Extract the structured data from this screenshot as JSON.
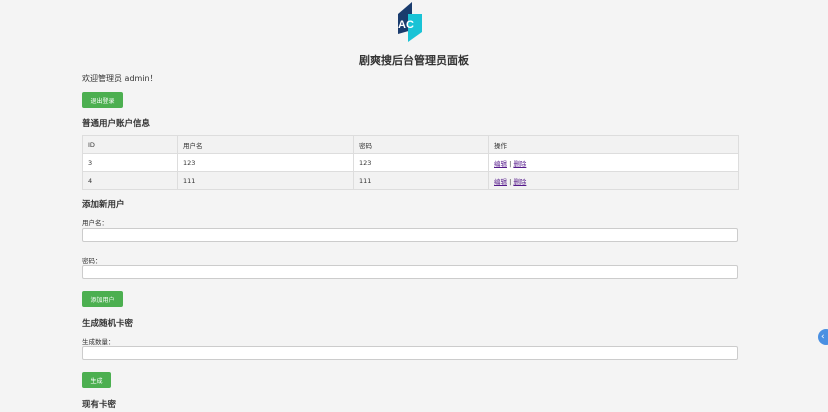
{
  "header": {
    "logo_text": "AC",
    "title": "剧爽搜后台管理员面板"
  },
  "welcome_text": "欢迎管理员 admin！",
  "logout_button": "退出登录",
  "users_section": {
    "heading": "普通用户账户信息",
    "columns": [
      "ID",
      "用户名",
      "密码",
      "操作"
    ],
    "rows": [
      {
        "id": "3",
        "username": "123",
        "password": "123",
        "edit": "编辑",
        "sep": "|",
        "delete": "删除"
      },
      {
        "id": "4",
        "username": "111",
        "password": "111",
        "edit": "编辑",
        "sep": "|",
        "delete": "删除"
      }
    ]
  },
  "add_user": {
    "heading": "添加新用户",
    "username_label": "用户名：",
    "username_value": "",
    "password_label": "密码：",
    "password_value": "",
    "submit_label": "添加用户"
  },
  "generate": {
    "heading": "生成随机卡密",
    "count_label": "生成数量：",
    "count_value": "",
    "submit_label": "生成"
  },
  "existing_cards_heading": "现有卡密",
  "side_handle_icon": "chevron-left-icon",
  "colors": {
    "button": "#4caf50",
    "logo_dark": "#1a3c6e",
    "logo_cyan": "#19c3d6",
    "side_handle": "#4a90e2"
  }
}
